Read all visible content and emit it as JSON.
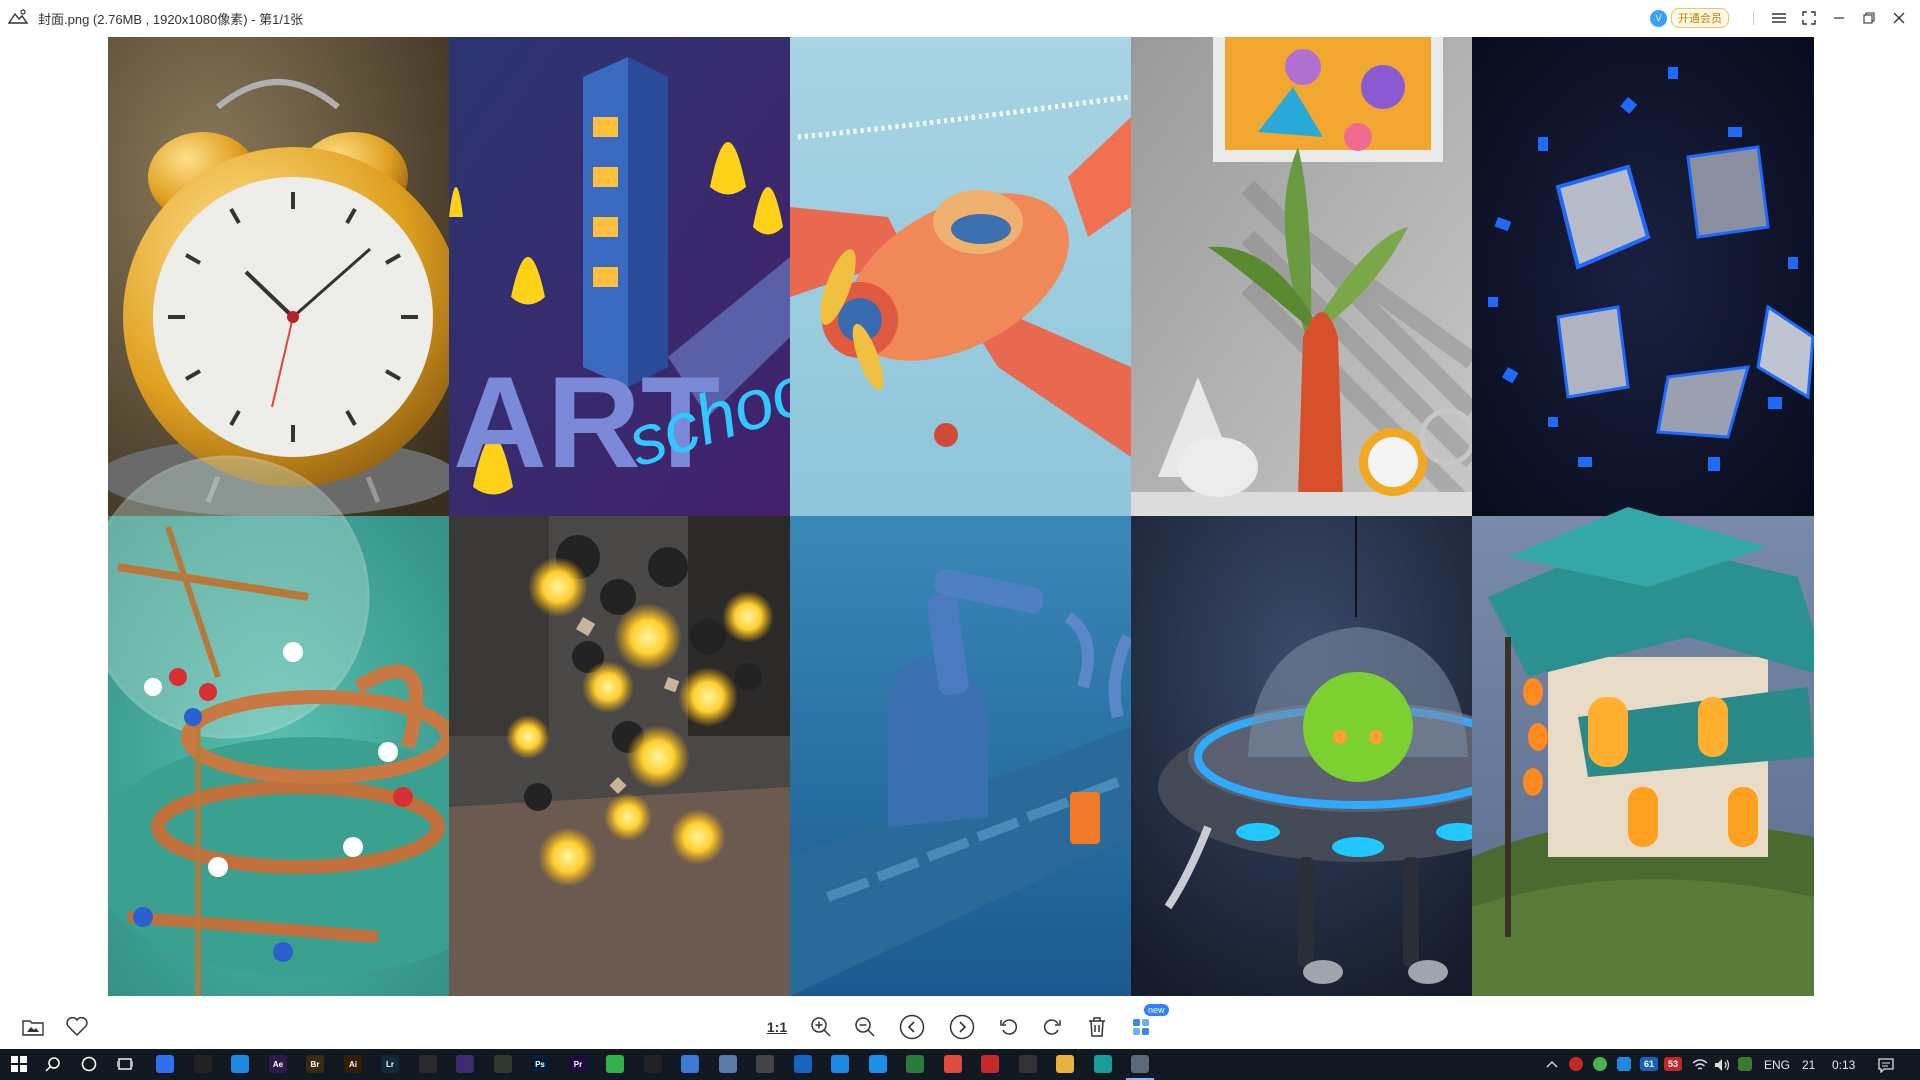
{
  "window": {
    "title": "封面.png (2.76MB , 1920x1080像素) - 第1/1张",
    "vip_label": "开通会员",
    "vip_avatar": "V"
  },
  "gallery": {
    "tiles": [
      {
        "name": "alarm-clock"
      },
      {
        "name": "art-school"
      },
      {
        "name": "airplane"
      },
      {
        "name": "plant-vase"
      },
      {
        "name": "chrome-shapes"
      },
      {
        "name": "marble-track"
      },
      {
        "name": "glowing-spheres"
      },
      {
        "name": "robot-arm"
      },
      {
        "name": "ufo"
      },
      {
        "name": "pagoda-house"
      }
    ],
    "art_text": "ART",
    "school_text": "schoo"
  },
  "toolbar": {
    "actual_size": "1:1",
    "new_badge": "new"
  },
  "taskbar": {
    "lang": "ENG",
    "time": "0:13",
    "date_short": "21",
    "tray_badge_1": "61",
    "tray_badge_2": "53",
    "apps": [
      {
        "icon": "qq-browser-icon",
        "label": "",
        "color": "#2e6ff0"
      },
      {
        "icon": "qq-icon",
        "label": "",
        "color": "#222"
      },
      {
        "icon": "app-blue-icon",
        "label": "",
        "color": "#1e88e5"
      },
      {
        "icon": "after-effects-icon",
        "label": "Ae",
        "color": "#2a1a4a"
      },
      {
        "icon": "bridge-icon",
        "label": "Br",
        "color": "#3a2a10"
      },
      {
        "icon": "illustrator-icon",
        "label": "Ai",
        "color": "#331c00"
      },
      {
        "icon": "lightroom-icon",
        "label": "Lr",
        "color": "#0d2a3a"
      },
      {
        "icon": "app-circle-icon",
        "label": "",
        "color": "#2a2a2a"
      },
      {
        "icon": "app-purple-icon",
        "label": "",
        "color": "#3d2a70"
      },
      {
        "icon": "app-green-icon",
        "label": "",
        "color": "#2f3a2f"
      },
      {
        "icon": "photoshop-icon",
        "label": "Ps",
        "color": "#001d34"
      },
      {
        "icon": "premiere-icon",
        "label": "Pr",
        "color": "#1e0a3c"
      },
      {
        "icon": "wechat-icon",
        "label": "",
        "color": "#2fb34a"
      },
      {
        "icon": "penguin-icon",
        "label": "",
        "color": "#222"
      },
      {
        "icon": "app-sphere-icon",
        "label": "",
        "color": "#3a7bd5"
      },
      {
        "icon": "app-window-icon",
        "label": "",
        "color": "#5a7aa8"
      },
      {
        "icon": "calculator-icon",
        "label": "",
        "color": "#444"
      },
      {
        "icon": "store-icon",
        "label": "",
        "color": "#1565c0"
      },
      {
        "icon": "thunder-icon",
        "label": "",
        "color": "#1e88e5"
      },
      {
        "icon": "edge-icon",
        "label": "",
        "color": "#1b8ee8"
      },
      {
        "icon": "app-leaf-icon",
        "label": "",
        "color": "#2a7a3a"
      },
      {
        "icon": "chrome-icon",
        "label": "",
        "color": "#e04a3a"
      },
      {
        "icon": "record-icon",
        "label": "",
        "color": "#c62828"
      },
      {
        "icon": "camera-icon",
        "label": "",
        "color": "#333"
      },
      {
        "icon": "folder-icon",
        "label": "",
        "color": "#e8b23a"
      },
      {
        "icon": "app-teal-icon",
        "label": "",
        "color": "#169c9c"
      },
      {
        "icon": "image-viewer-icon",
        "label": "",
        "color": "#5a6a7a"
      }
    ]
  }
}
